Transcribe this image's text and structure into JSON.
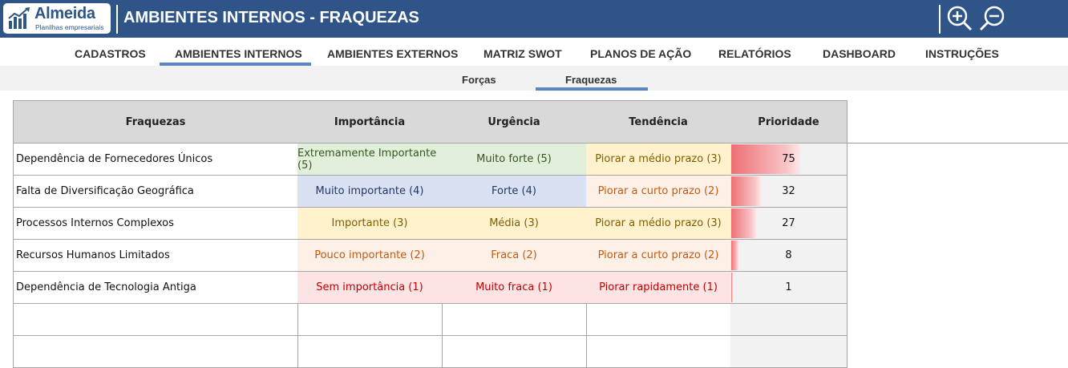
{
  "header": {
    "logo_name": "Almeida",
    "logo_subtitle": "Planilhas empresariais",
    "title": "AMBIENTES INTERNOS - FRAQUEZAS",
    "zoom_in_icon": "zoom-in-icon",
    "zoom_out_icon": "zoom-out-icon",
    "bg_color": "#2f5487"
  },
  "nav": {
    "items": [
      {
        "label": "CADASTROS"
      },
      {
        "label": "AMBIENTES INTERNOS",
        "active": true
      },
      {
        "label": "AMBIENTES EXTERNOS"
      },
      {
        "label": "MATRIZ SWOT"
      },
      {
        "label": "PLANOS DE AÇÃO"
      },
      {
        "label": "RELATÓRIOS"
      },
      {
        "label": "DASHBOARD"
      },
      {
        "label": "INSTRUÇÕES"
      }
    ]
  },
  "subnav": {
    "items": [
      {
        "label": "Forças"
      },
      {
        "label": "Fraquezas",
        "active": true
      }
    ]
  },
  "table": {
    "headers": [
      "Fraquezas",
      "Importância",
      "Urgência",
      "Tendência",
      "Prioridade"
    ],
    "priority_max": 125,
    "rows": [
      {
        "name": "Dependência de Fornecedores Únicos",
        "importancia": "Extremamente Importante (5)",
        "urgencia": "Muito forte (5)",
        "tendencia": "Piorar a médio prazo (3)",
        "prioridade": 75
      },
      {
        "name": "Falta de Diversificação Geográfica",
        "importancia": "Muito importante (4)",
        "urgencia": "Forte (4)",
        "tendencia": "Piorar a curto prazo (2)",
        "prioridade": 32
      },
      {
        "name": "Processos Internos Complexos",
        "importancia": "Importante (3)",
        "urgencia": "Média (3)",
        "tendencia": "Piorar a médio prazo (3)",
        "prioridade": 27
      },
      {
        "name": "Recursos Humanos Limitados",
        "importancia": "Pouco importante (2)",
        "urgencia": "Fraca (2)",
        "tendencia": "Piorar a curto prazo (2)",
        "prioridade": 8
      },
      {
        "name": "Dependência de Tecnologia Antiga",
        "importancia": "Sem importância (1)",
        "urgencia": "Muito fraca (1)",
        "tendencia": "Piorar rapidamente (1)",
        "prioridade": 1
      },
      {
        "name": "",
        "importancia": "",
        "urgencia": "",
        "tendencia": "",
        "prioridade": null
      },
      {
        "name": "",
        "importancia": "",
        "urgencia": "",
        "tendencia": "",
        "prioridade": null
      }
    ]
  },
  "level_styles": {
    "5": {
      "bg": "#e2efda",
      "fg": "#375623"
    },
    "4": {
      "bg": "#d9e1f2",
      "fg": "#203864"
    },
    "3": {
      "bg": "#fff2cc",
      "fg": "#7f6000"
    },
    "2": {
      "bg": "#fdf1e7",
      "fg": "#c55a11"
    },
    "1": {
      "bg": "#fce4e4",
      "fg": "#c00000"
    }
  }
}
